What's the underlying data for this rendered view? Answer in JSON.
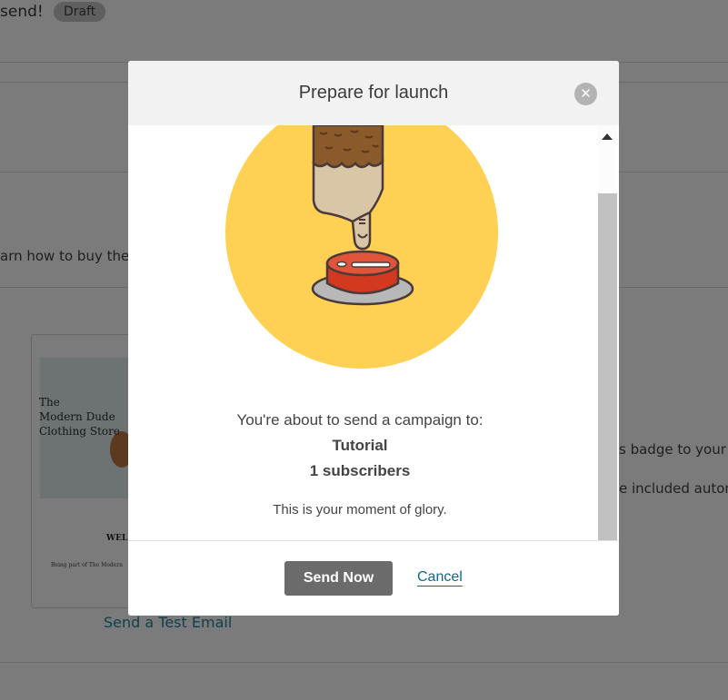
{
  "background": {
    "title": "send!",
    "badge": "Draft",
    "learn_text": "arn how to buy the",
    "badge_text": "s badge to your f",
    "included_text": "e included autom",
    "card": {
      "preview_lines": [
        "The",
        "Modern Dude",
        "Clothing Store"
      ],
      "heading": "WEL",
      "small_text": "Being part of The Modern"
    },
    "test_email_link": "Send a Test Email"
  },
  "modal": {
    "title": "Prepare for launch",
    "close_icon": "close-icon",
    "illustration_icon": "finger-pressing-button-icon",
    "intro": "You're about to send a campaign to:",
    "list_name": "Tutorial",
    "subscriber_count": "1 subscribers",
    "tagline": "This is your moment of glory.",
    "send_label": "Send Now",
    "cancel_label": "Cancel"
  },
  "colors": {
    "overlay": "#7b7b7b",
    "header_bg": "#f2f2f2",
    "circle": "#fed054",
    "button_red": "#d2391f",
    "send_button": "#6b6b6b",
    "cancel_link": "#11678a"
  }
}
